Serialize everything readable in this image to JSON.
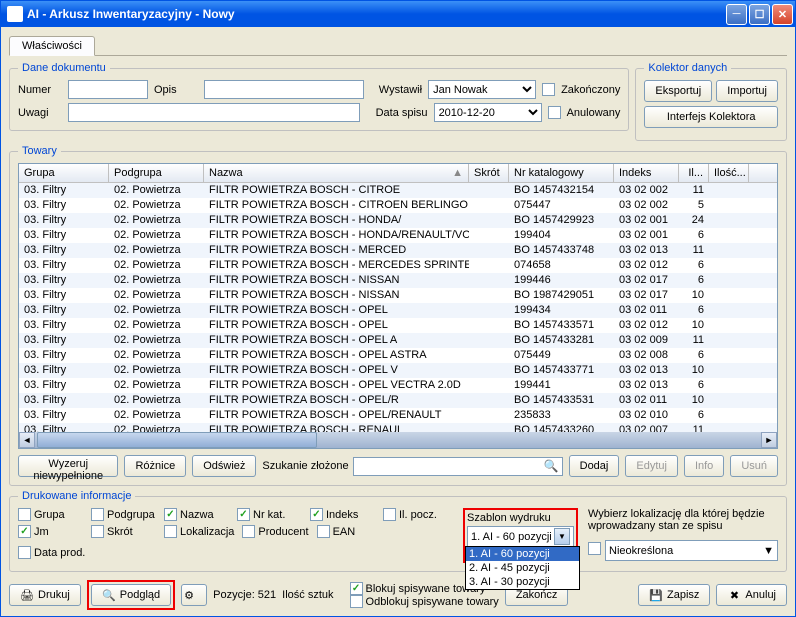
{
  "window": {
    "title": "AI - Arkusz Inwentaryzacyjny - Nowy"
  },
  "tabs": {
    "properties": "Właściwości"
  },
  "dane": {
    "legend": "Dane dokumentu",
    "numer_lbl": "Numer",
    "opis_lbl": "Opis",
    "wystawil_lbl": "Wystawił",
    "wystawil_val": "Jan Nowak",
    "zakonczony": "Zakończony",
    "uwagi_lbl": "Uwagi",
    "dataspisu_lbl": "Data spisu",
    "dataspisu_val": "2010-12-20",
    "anulowany": "Anulowany"
  },
  "kolektor": {
    "legend": "Kolektor danych",
    "eksportuj": "Eksportuj",
    "importuj": "Importuj",
    "interfejs": "Interfejs Kolektora"
  },
  "towary": {
    "legend": "Towary",
    "headers": {
      "grupa": "Grupa",
      "podgrupa": "Podgrupa",
      "nazwa": "Nazwa",
      "skrot": "Skrót",
      "nrkat": "Nr katalogowy",
      "indeks": "Indeks",
      "il": "Il...",
      "ilosc": "Ilość..."
    },
    "rows": [
      {
        "g": "03. Filtry",
        "p": "02. Powietrza",
        "n": "FILTR POWIETRZA BOSCH - CITROE",
        "s": "",
        "nr": "BO 1457432154",
        "i": "03 02 002",
        "il": "11"
      },
      {
        "g": "03. Filtry",
        "p": "02. Powietrza",
        "n": "FILTR POWIETRZA BOSCH - CITROEN BERLINGO",
        "s": "",
        "nr": "075447",
        "i": "03 02 002",
        "il": "5"
      },
      {
        "g": "03. Filtry",
        "p": "02. Powietrza",
        "n": "FILTR POWIETRZA BOSCH - HONDA/",
        "s": "",
        "nr": "BO 1457429923",
        "i": "03 02 001",
        "il": "24"
      },
      {
        "g": "03. Filtry",
        "p": "02. Powietrza",
        "n": "FILTR POWIETRZA BOSCH - HONDA/RENAULT/VO",
        "s": "",
        "nr": "199404",
        "i": "03 02 001",
        "il": "6"
      },
      {
        "g": "03. Filtry",
        "p": "02. Powietrza",
        "n": "FILTR POWIETRZA BOSCH - MERCED",
        "s": "",
        "nr": "BO 1457433748",
        "i": "03 02 013",
        "il": "11"
      },
      {
        "g": "03. Filtry",
        "p": "02. Powietrza",
        "n": "FILTR POWIETRZA BOSCH - MERCEDES SPRINTE",
        "s": "",
        "nr": "074658",
        "i": "03 02 012",
        "il": "6"
      },
      {
        "g": "03. Filtry",
        "p": "02. Powietrza",
        "n": "FILTR POWIETRZA BOSCH - NISSAN",
        "s": "",
        "nr": "199446",
        "i": "03 02 017",
        "il": "6"
      },
      {
        "g": "03. Filtry",
        "p": "02. Powietrza",
        "n": "FILTR POWIETRZA BOSCH - NISSAN",
        "s": "",
        "nr": "BO 1987429051",
        "i": "03 02 017",
        "il": "10"
      },
      {
        "g": "03. Filtry",
        "p": "02. Powietrza",
        "n": "FILTR POWIETRZA BOSCH - OPEL",
        "s": "",
        "nr": "199434",
        "i": "03 02 011",
        "il": "6"
      },
      {
        "g": "03. Filtry",
        "p": "02. Powietrza",
        "n": "FILTR POWIETRZA BOSCH - OPEL",
        "s": "",
        "nr": "BO 1457433571",
        "i": "03 02 012",
        "il": "10"
      },
      {
        "g": "03. Filtry",
        "p": "02. Powietrza",
        "n": "FILTR POWIETRZA BOSCH - OPEL A",
        "s": "",
        "nr": "BO 1457433281",
        "i": "03 02 009",
        "il": "11"
      },
      {
        "g": "03. Filtry",
        "p": "02. Powietrza",
        "n": "FILTR POWIETRZA BOSCH - OPEL ASTRA",
        "s": "",
        "nr": "075449",
        "i": "03 02 008",
        "il": "6"
      },
      {
        "g": "03. Filtry",
        "p": "02. Powietrza",
        "n": "FILTR POWIETRZA BOSCH - OPEL V",
        "s": "",
        "nr": "BO 1457433771",
        "i": "03 02 013",
        "il": "10"
      },
      {
        "g": "03. Filtry",
        "p": "02. Powietrza",
        "n": "FILTR POWIETRZA BOSCH - OPEL VECTRA 2.0D",
        "s": "",
        "nr": "199441",
        "i": "03 02 013",
        "il": "6"
      },
      {
        "g": "03. Filtry",
        "p": "02. Powietrza",
        "n": "FILTR POWIETRZA BOSCH - OPEL/R",
        "s": "",
        "nr": "BO 1457433531",
        "i": "03 02 011",
        "il": "10"
      },
      {
        "g": "03. Filtry",
        "p": "02. Powietrza",
        "n": "FILTR POWIETRZA BOSCH - OPEL/RENAULT",
        "s": "",
        "nr": "235833",
        "i": "03 02 010",
        "il": "6"
      },
      {
        "g": "03. Filtry",
        "p": "02. Powietrza",
        "n": "FILTR POWIETRZA BOSCH - RENAUL",
        "s": "",
        "nr": "BO 1457433260",
        "i": "03 02 007",
        "il": "11"
      }
    ],
    "wyzeruj": "Wyzeruj niewypełnione",
    "roznice": "Różnice",
    "odswiez": "Odśwież",
    "szukanie": "Szukanie złożone",
    "dodaj": "Dodaj",
    "edytuj": "Edytuj",
    "info": "Info",
    "usun": "Usuń"
  },
  "drukowane": {
    "legend": "Drukowane informacje",
    "grupa": "Grupa",
    "podgrupa": "Podgrupa",
    "nazwa": "Nazwa",
    "nrkat": "Nr kat.",
    "indeks": "Indeks",
    "ilpocz": "Il. pocz.",
    "jm": "Jm",
    "skrot": "Skrót",
    "lokalizacja": "Lokalizacja",
    "producent": "Producent",
    "ean": "EAN",
    "dataprod": "Data prod.",
    "szablon_lbl": "Szablon wydruku",
    "szablon_val": "1. AI - 60 pozycji",
    "options": [
      "1. AI - 60 pozycji",
      "2. AI - 45 pozycji",
      "3. AI - 30 pozycji"
    ],
    "lokal_lbl": "Wybierz lokalizację dla której będzie wprowadzany stan ze spisu",
    "lokal_val": "Nieokreślona"
  },
  "footer": {
    "drukuj": "Drukuj",
    "podglad": "Podgląd",
    "pozycje": "Pozycje: 521",
    "iloscsztuk": "Ilość sztuk",
    "blokuj": "Blokuj spisywane towary",
    "odblokuj": "Odblokuj spisywane towary",
    "zakoncz": "Zakończ",
    "zapisz": "Zapisz",
    "anuluj": "Anuluj"
  }
}
